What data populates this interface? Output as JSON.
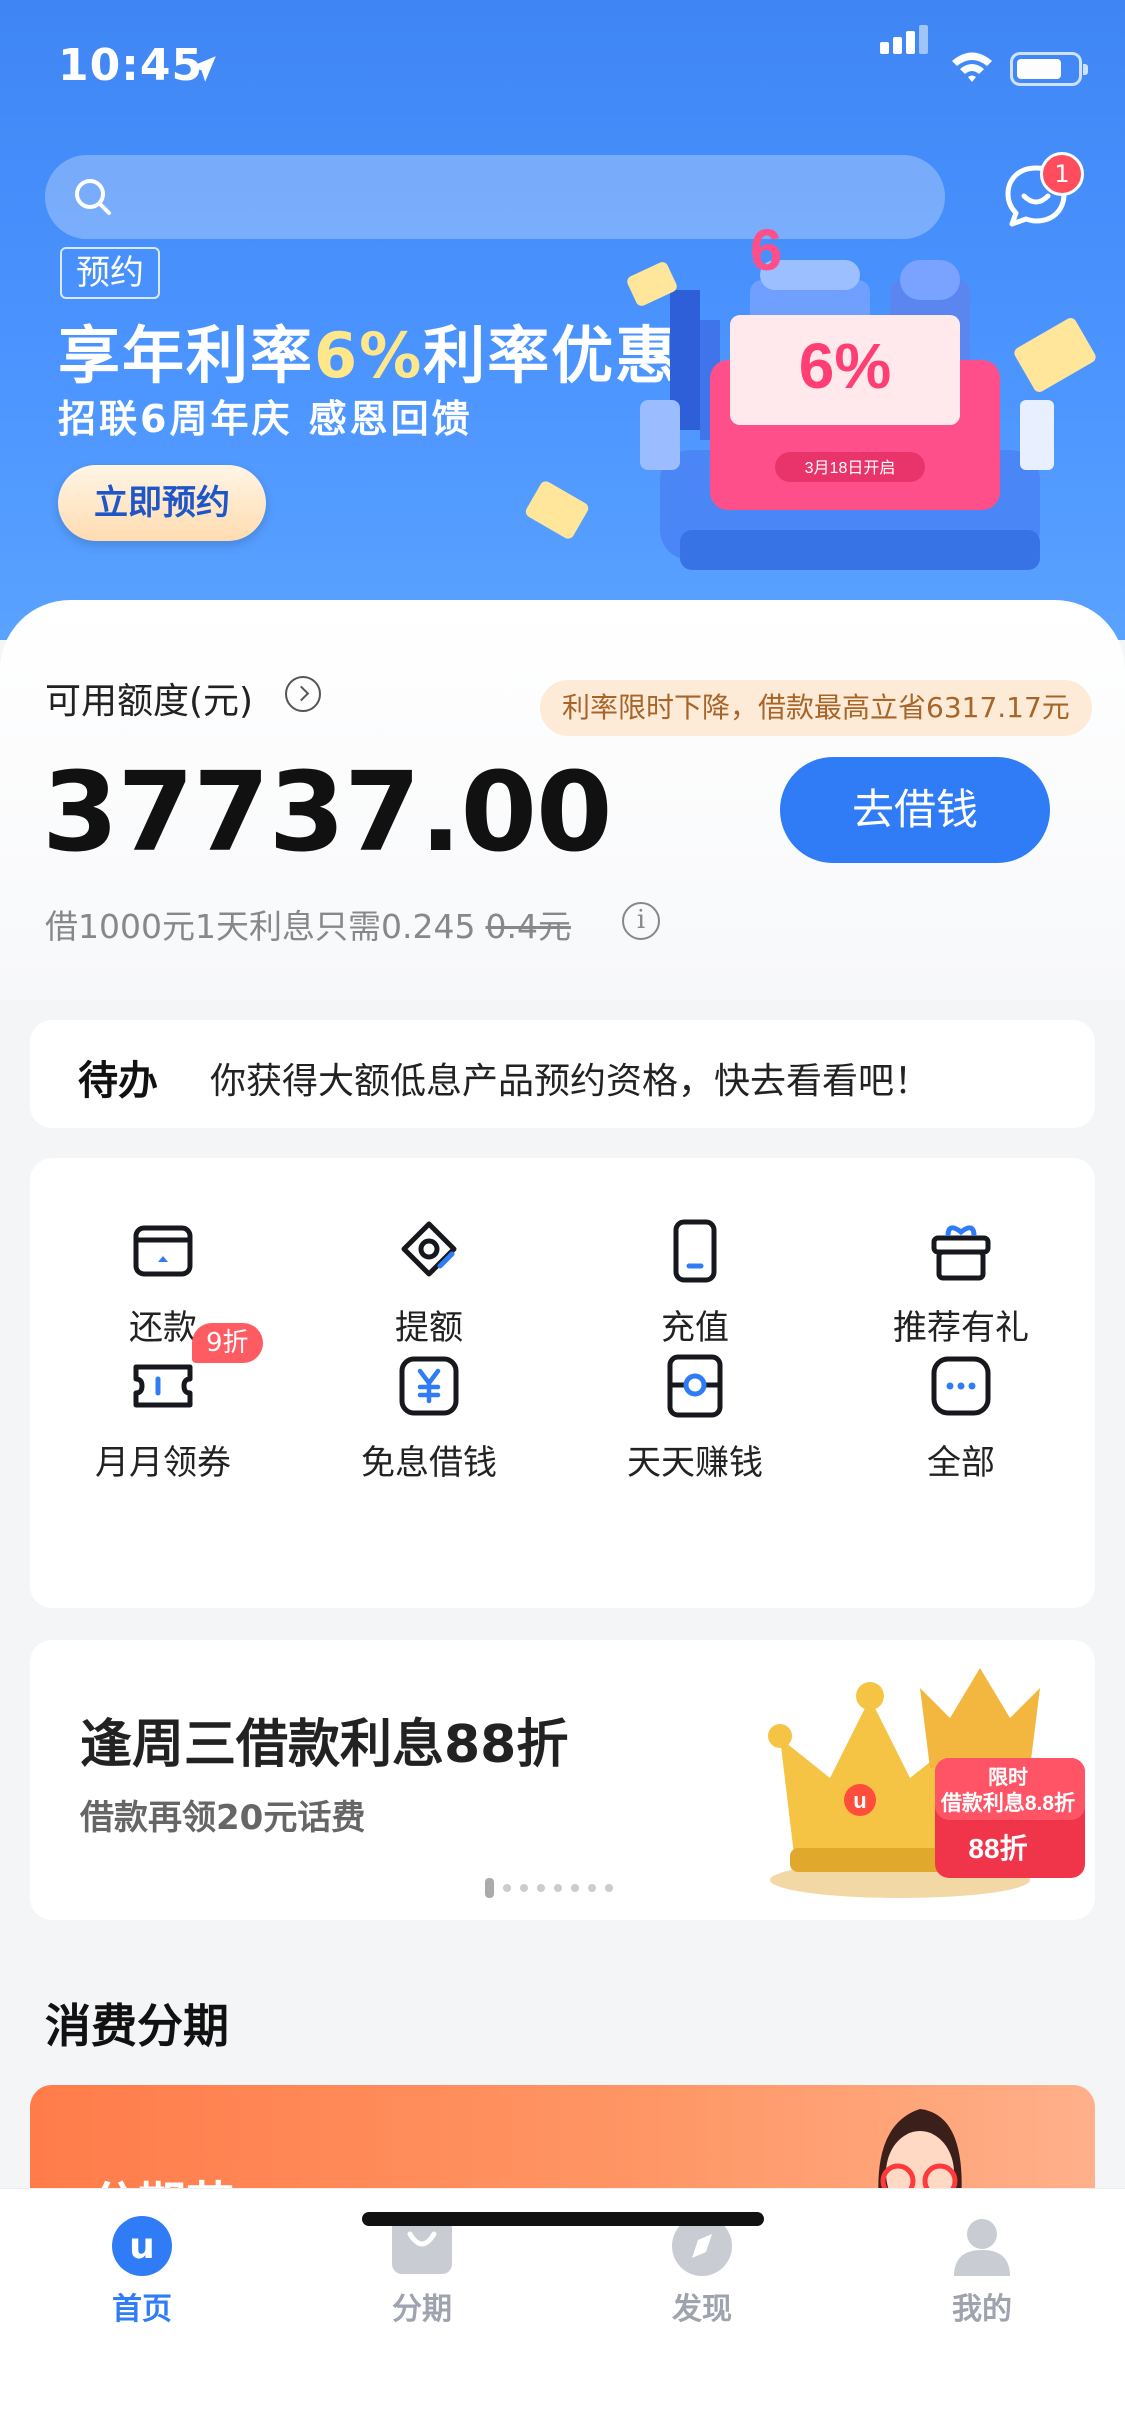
{
  "status_bar": {
    "time": "10:45",
    "battery_level": 0.75
  },
  "search": {
    "placeholder": "",
    "notification_count": "1"
  },
  "hero_banner": {
    "tag": "预约",
    "title_prefix": "享年利率",
    "title_highlight": "6%",
    "title_suffix": "利率优惠",
    "subtitle": "招联6周年庆 感恩回馈",
    "button_label": "立即预约",
    "art_percent": "6%",
    "art_date": "3月18日开启",
    "art_number": "6"
  },
  "credit": {
    "label": "可用额度(元)",
    "amount": "37737.00",
    "promo_tip": "利率限时下降，借款最高立省6317.17元",
    "borrow_button": "去借钱",
    "interest_text": "借1000元1天利息只需0.245",
    "interest_original": "0.4",
    "interest_unit": "元",
    "info_glyph": "i"
  },
  "todo": {
    "label": "待办",
    "text": "你获得大额低息产品预约资格，快去看看吧！"
  },
  "quick_actions": [
    {
      "label": "还款",
      "icon": "repay-icon"
    },
    {
      "label": "提额",
      "icon": "raise-limit-icon"
    },
    {
      "label": "充值",
      "icon": "phone-recharge-icon"
    },
    {
      "label": "推荐有礼",
      "icon": "gift-icon"
    },
    {
      "label": "月月领券",
      "icon": "ticket-icon",
      "badge": "9折"
    },
    {
      "label": "免息借钱",
      "icon": "yuan-icon"
    },
    {
      "label": "天天赚钱",
      "icon": "earn-icon"
    },
    {
      "label": "全部",
      "icon": "more-icon"
    }
  ],
  "promo": {
    "title": "逢周三借款利息88折",
    "subtitle": "借款再领20元话费",
    "art_tag": "限时",
    "art_text": "借款利息8.8折",
    "art_badge": "88折",
    "art_logo": "u",
    "dot_count": 8,
    "active_dot": 0
  },
  "installment": {
    "section_title": "消费分期",
    "card_title": "分期节"
  },
  "tab_bar": {
    "items": [
      {
        "label": "首页",
        "icon": "home-icon",
        "active": true,
        "glyph": "u"
      },
      {
        "label": "分期",
        "icon": "bag-icon",
        "active": false
      },
      {
        "label": "发现",
        "icon": "compass-icon",
        "active": false
      },
      {
        "label": "我的",
        "icon": "profile-icon",
        "active": false
      }
    ]
  },
  "colors": {
    "primary": "#2f7cf6",
    "hero": "#4b94ff",
    "badge": "#ff5b63",
    "promo_text": "#a8652a"
  }
}
